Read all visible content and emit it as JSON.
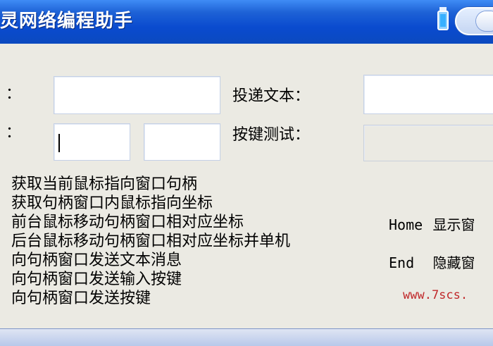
{
  "window": {
    "title": "灵网络编程助手",
    "accent": "#0a4bcf"
  },
  "form": {
    "colon_1": "：",
    "colon_2": "：",
    "post_text_label": "投递文本：",
    "key_test_label": "按键测试："
  },
  "actions": [
    "获取当前鼠标指向窗口句柄",
    "获取句柄窗口内鼠标指向坐标",
    "前台鼠标移动句柄窗口相对应坐标",
    "后台鼠标移动句柄窗口相对应坐标并单机",
    "向句柄窗口发送文本消息",
    "向句柄窗口发送输入按键",
    "向句柄窗口发送按键"
  ],
  "hotkeys": [
    {
      "key": "Home",
      "desc": "显示窗"
    },
    {
      "key": "End",
      "desc": "隐藏窗"
    }
  ],
  "footer": {
    "url": "www.7scs."
  }
}
